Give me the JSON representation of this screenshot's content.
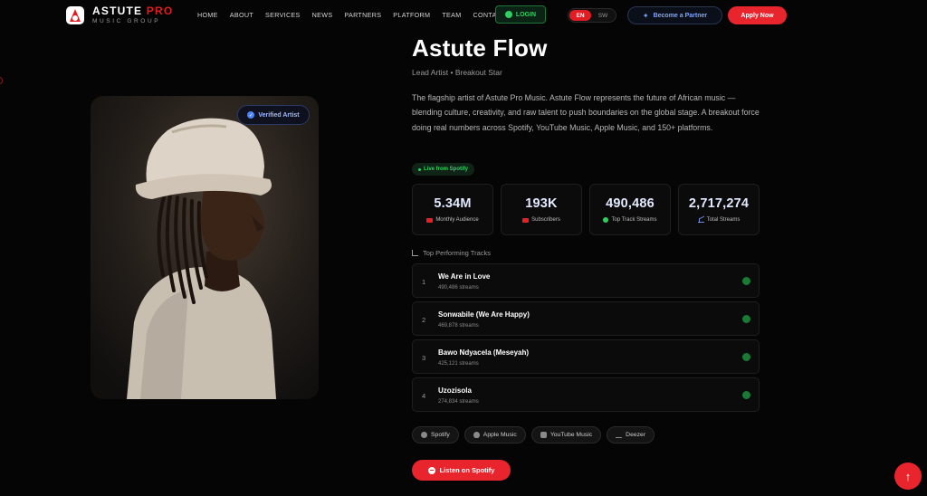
{
  "nav": {
    "brand_name_1": "ASTUTE",
    "brand_name_2": "PRO",
    "brand_sub": "MUSIC GROUP",
    "links": [
      "HOME",
      "ABOUT",
      "SERVICES",
      "NEWS",
      "PARTNERS",
      "PLATFORM",
      "TEAM",
      "CONTACT"
    ],
    "login": "LOGIN",
    "lang_en": "EN",
    "lang_sw": "SW",
    "partner": "Become a Partner",
    "apply": "Apply Now"
  },
  "photo": {
    "verified": "Verified Artist"
  },
  "artist": {
    "name": "Astute Flow",
    "subtitle": "Lead Artist • Breakout Star",
    "description": "The flagship artist of Astute Pro Music. Astute Flow represents the future of African music — blending culture, creativity, and raw talent to push boundaries on the global stage. A breakout force doing real numbers across Spotify, YouTube Music, Apple Music, and 150+ platforms."
  },
  "live": "Live from Spotify",
  "stats": [
    {
      "value": "5.34M",
      "label": "Monthly Audience"
    },
    {
      "value": "193K",
      "label": "Subscribers"
    },
    {
      "value": "490,486",
      "label": "Top Track Streams"
    },
    {
      "value": "2,717,274",
      "label": "Total Streams"
    }
  ],
  "tracks_heading": "Top Performing Tracks",
  "tracks": [
    {
      "num": "1",
      "name": "We Are in Love",
      "streams": "490,486 streams"
    },
    {
      "num": "2",
      "name": "Sonwabile (We Are Happy)",
      "streams": "469,878 streams"
    },
    {
      "num": "3",
      "name": "Bawo Ndyacela (Meseyah)",
      "streams": "425,121 streams"
    },
    {
      "num": "4",
      "name": "Uzozisola",
      "streams": "274,834 streams"
    }
  ],
  "platforms": [
    "Spotify",
    "Apple Music",
    "YouTube Music",
    "Deezer"
  ],
  "listen": "Listen on Spotify",
  "colors": {
    "accent": "#e8242c",
    "green": "#2fd061",
    "blue": "#4a82ff"
  }
}
